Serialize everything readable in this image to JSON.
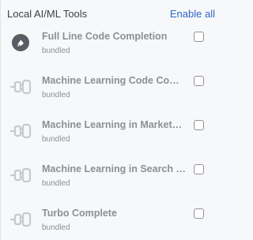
{
  "header": {
    "title": "Local AI/ML Tools",
    "enable_all": "Enable all"
  },
  "plugins": [
    {
      "name": "Full Line Code Completion",
      "tag": "bundled",
      "icon": "full-line-code-completion-icon",
      "checked": false
    },
    {
      "name": "Machine Learning Code Compl...",
      "tag": "bundled",
      "icon": "plugin-plug-icon",
      "checked": false
    },
    {
      "name": "Machine Learning in Marketplace",
      "tag": "bundled",
      "icon": "plugin-plug-icon",
      "checked": false
    },
    {
      "name": "Machine Learning in Search Eve...",
      "tag": "bundled",
      "icon": "plugin-plug-icon",
      "checked": false
    },
    {
      "name": "Turbo Complete",
      "tag": "bundled",
      "icon": "plugin-plug-icon",
      "checked": false
    }
  ],
  "colors": {
    "link": "#2f67c9",
    "muted_text": "#8c8f96",
    "icon_gray": "#c7c9cd",
    "logo_dark": "#5a5d63"
  }
}
